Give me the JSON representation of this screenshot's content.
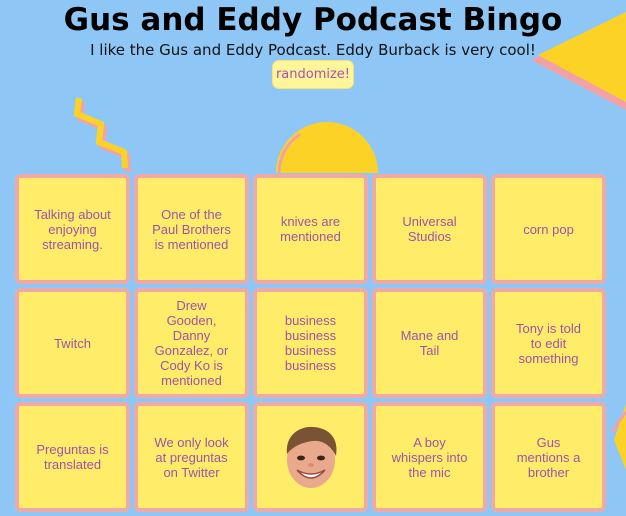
{
  "header": {
    "title": "Gus and Eddy Podcast Bingo",
    "subtitle": "I like the Gus and Eddy Podcast. Eddy Burback is very cool!",
    "randomize_label": "randomize!"
  },
  "colors": {
    "background": "#8ec7f6",
    "cell_fill": "#ffed6a",
    "cell_border": "#efaaa8",
    "cell_text": "#a053a6",
    "decor_yellow": "#fdd227",
    "decor_pink": "#f2a2a6"
  },
  "board": {
    "cells": [
      {
        "text": "Talking about enjoying streaming."
      },
      {
        "text": "One of the Paul Brothers is mentioned"
      },
      {
        "text": "knives are mentioned"
      },
      {
        "text": "Universal Studios"
      },
      {
        "text": "corn pop"
      },
      {
        "text": "Twitch"
      },
      {
        "text": "Drew Gooden, Danny Gonzalez, or Cody Ko is mentioned"
      },
      {
        "text": "business business business business"
      },
      {
        "text": "Mane and Tail"
      },
      {
        "text": "Tony is told to edit something"
      },
      {
        "text": "Preguntas is translated"
      },
      {
        "text": "We only look at preguntas on Twitter"
      },
      {
        "text": "",
        "free_space": true,
        "icon": "eddy-face-icon"
      },
      {
        "text": "A boy whispers into the mic"
      },
      {
        "text": "Gus mentions a brother"
      }
    ]
  }
}
